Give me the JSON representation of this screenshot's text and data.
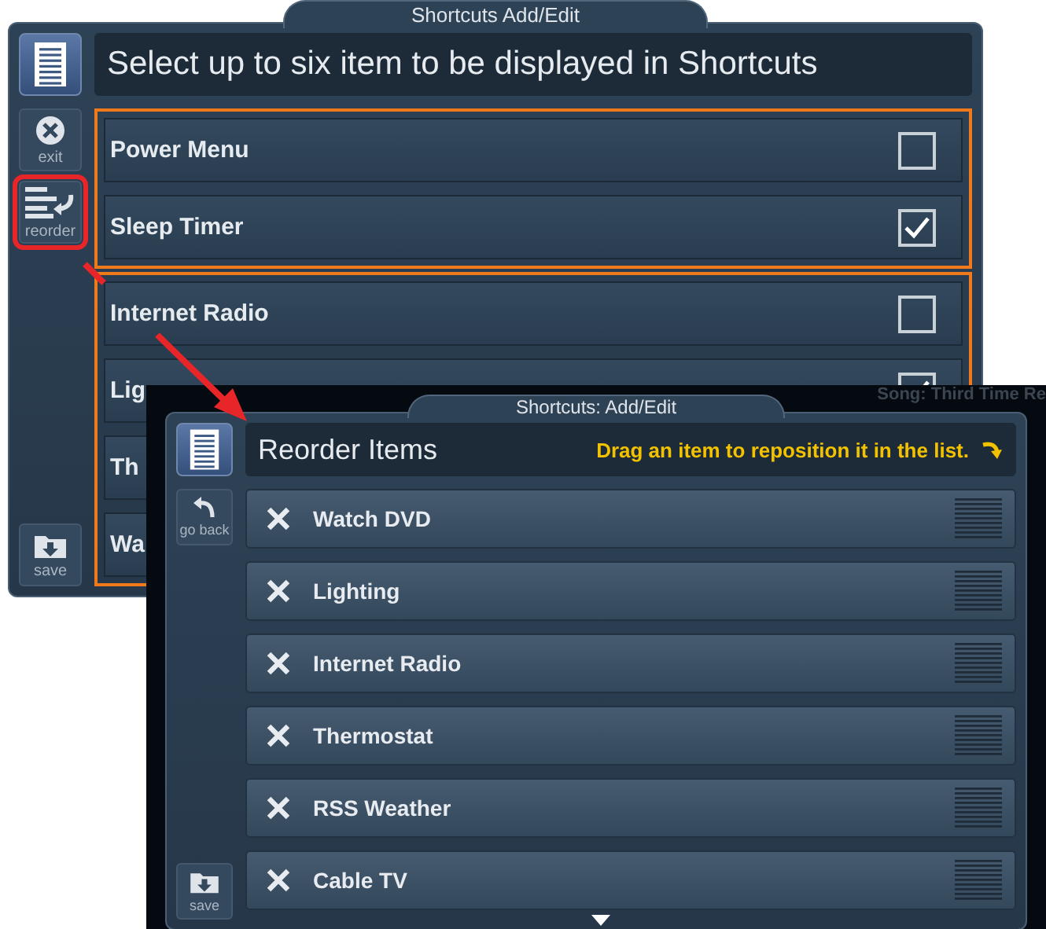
{
  "back_window": {
    "tab_title": "Shortcuts Add/Edit",
    "heading": "Select up to six item to be displayed in Shortcuts",
    "side_buttons": [
      {
        "kind": "exit",
        "label": "exit",
        "highlighted": false
      },
      {
        "kind": "reorder",
        "label": "reorder",
        "highlighted": true
      },
      {
        "kind": "save",
        "label": "save",
        "highlighted": false
      }
    ],
    "groups": [
      {
        "items": [
          {
            "label": "Power Menu",
            "checked": false
          },
          {
            "label": "Sleep Timer",
            "checked": true
          }
        ]
      },
      {
        "items": [
          {
            "label": "Internet Radio",
            "checked": false
          },
          {
            "label": "Lig",
            "checked": true
          },
          {
            "label": "Th"
          },
          {
            "label": "Wa"
          }
        ]
      }
    ]
  },
  "front_window": {
    "status_text": "Song: Third Time Re",
    "tab_title": "Shortcuts: Add/Edit",
    "heading": "Reorder Items",
    "hint": "Drag an item to reposition it in the list.",
    "side_buttons": [
      {
        "kind": "back",
        "label": "go back"
      },
      {
        "kind": "save",
        "label": "save"
      }
    ],
    "items": [
      {
        "label": "Watch DVD"
      },
      {
        "label": "Lighting"
      },
      {
        "label": "Internet Radio"
      },
      {
        "label": "Thermostat"
      },
      {
        "label": "RSS Weather"
      },
      {
        "label": "Cable TV"
      }
    ]
  }
}
